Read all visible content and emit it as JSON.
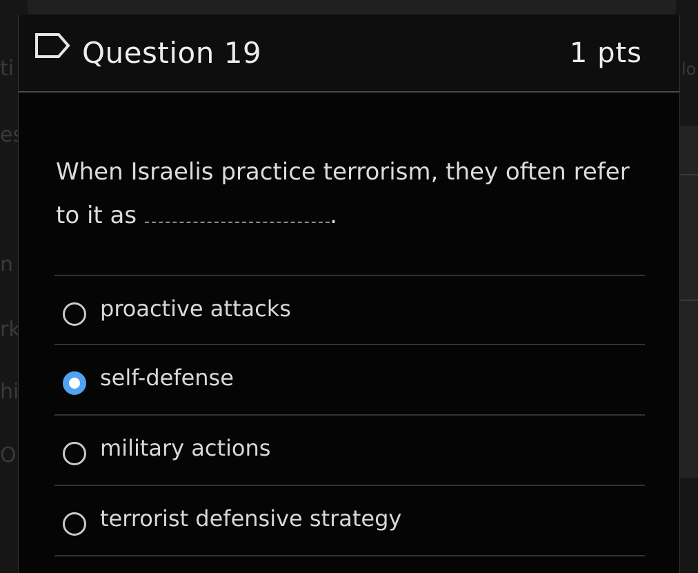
{
  "question": {
    "title": "Question 19",
    "points": "1 pts",
    "text_before_blank": "When Israelis practice terrorism, they often refer to it as",
    "text_after_blank": ".",
    "flag_icon": "flag-outline-icon"
  },
  "answers": [
    {
      "label": "proactive attacks",
      "selected": false
    },
    {
      "label": "self-defense",
      "selected": true
    },
    {
      "label": "military actions",
      "selected": false
    },
    {
      "label": "terrorist defensive strategy",
      "selected": false
    }
  ],
  "background_fragments": [
    "ti",
    "es",
    "n",
    "rk",
    "hi",
    "O",
    "lo"
  ],
  "colors": {
    "card_background": "#050505",
    "header_background": "#0e0e0e",
    "radio_selected": "#4fa3f0",
    "text": "#dcdcdc"
  }
}
